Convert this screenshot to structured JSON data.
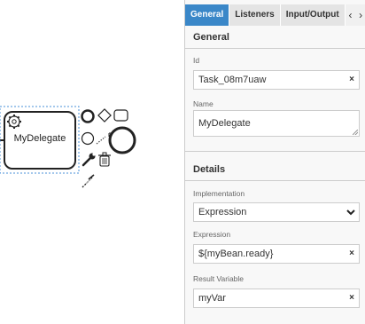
{
  "canvas": {
    "task_label": "MyDelegate"
  },
  "panel": {
    "tabs": [
      "General",
      "Listeners",
      "Input/Output"
    ],
    "nav_prev": "‹",
    "nav_next": "›",
    "general": {
      "title": "General",
      "id_label": "Id",
      "id_value": "Task_08m7uaw",
      "name_label": "Name",
      "name_value": "MyDelegate"
    },
    "details": {
      "title": "Details",
      "implementation_label": "Implementation",
      "implementation_value": "Expression",
      "expression_label": "Expression",
      "expression_value": "${myBean.ready}",
      "result_variable_label": "Result Variable",
      "result_variable_value": "myVar"
    },
    "clear_glyph": "×"
  },
  "colors": {
    "active_tab": "#3a87c8",
    "selection_outline": "#4a90d9",
    "stroke": "#222222"
  }
}
